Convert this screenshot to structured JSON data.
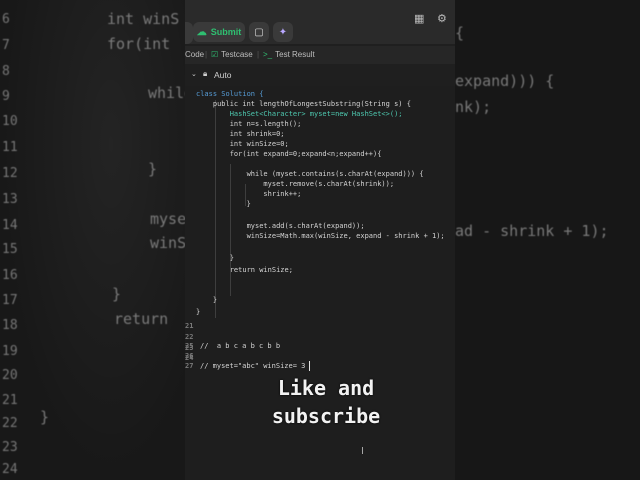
{
  "toolbar": {
    "submit_label": "Submit",
    "tabs": [
      {
        "label": "Code"
      },
      {
        "label": "Testcase"
      },
      {
        "label": "Test Result"
      }
    ]
  },
  "editor": {
    "language_mode": "Auto",
    "lines": [
      {
        "num": "",
        "text": "class Solution {"
      },
      {
        "num": "",
        "text": "    public int lengthOfLongestSubstring(String s) {"
      },
      {
        "num": "",
        "text": "        HashSet<Character> myset=new HashSet<>();"
      },
      {
        "num": "",
        "text": "        int n=s.length();"
      },
      {
        "num": "",
        "text": "        int shrink=0;"
      },
      {
        "num": "",
        "text": "        int winSize=0;"
      },
      {
        "num": "",
        "text": "        for(int expand=0;expand<n;expand++){"
      },
      {
        "num": "",
        "text": ""
      },
      {
        "num": "",
        "text": "            while (myset.contains(s.charAt(expand))) {"
      },
      {
        "num": "",
        "text": "                myset.remove(s.charAt(shrink));"
      },
      {
        "num": "",
        "text": "                shrink++;"
      },
      {
        "num": "",
        "text": "            }"
      },
      {
        "num": "",
        "text": ""
      },
      {
        "num": "",
        "text": "            myset.add(s.charAt(expand));"
      },
      {
        "num": "",
        "text": "            winSize=Math.max(winSize, expand - shrink + 1);"
      },
      {
        "num": "",
        "text": ""
      },
      {
        "num": "",
        "text": "        }"
      },
      {
        "num": "",
        "text": "        return winSize;"
      },
      {
        "num": "",
        "text": ""
      },
      {
        "num": "",
        "text": "    }"
      },
      {
        "num": "21",
        "text": "}"
      },
      {
        "num": "22",
        "text": ""
      },
      {
        "num": "23",
        "text": ""
      },
      {
        "num": "24",
        "text": ""
      },
      {
        "num": "25",
        "text": "//  a b c a b c b b"
      },
      {
        "num": "26",
        "text": ""
      },
      {
        "num": "27",
        "text": "// myset=\"abc\" winSize= 3"
      }
    ]
  },
  "overlay": {
    "line1": "Like and",
    "line2": "subscribe"
  },
  "background_left": {
    "lines": [
      "int winS",
      "for(int",
      "while",
      "}",
      "myset",
      "winSi",
      "}",
      "return",
      "}"
    ],
    "numbers": [
      "6",
      "7",
      "8",
      "9",
      "10",
      "11",
      "12",
      "13",
      "14",
      "15",
      "16",
      "17",
      "18",
      "19",
      "20",
      "21",
      "22",
      "23",
      "24"
    ]
  },
  "background_right": {
    "lines": [
      "{",
      "expand))) {",
      "nk);",
      "ad - shrink + 1);"
    ]
  }
}
